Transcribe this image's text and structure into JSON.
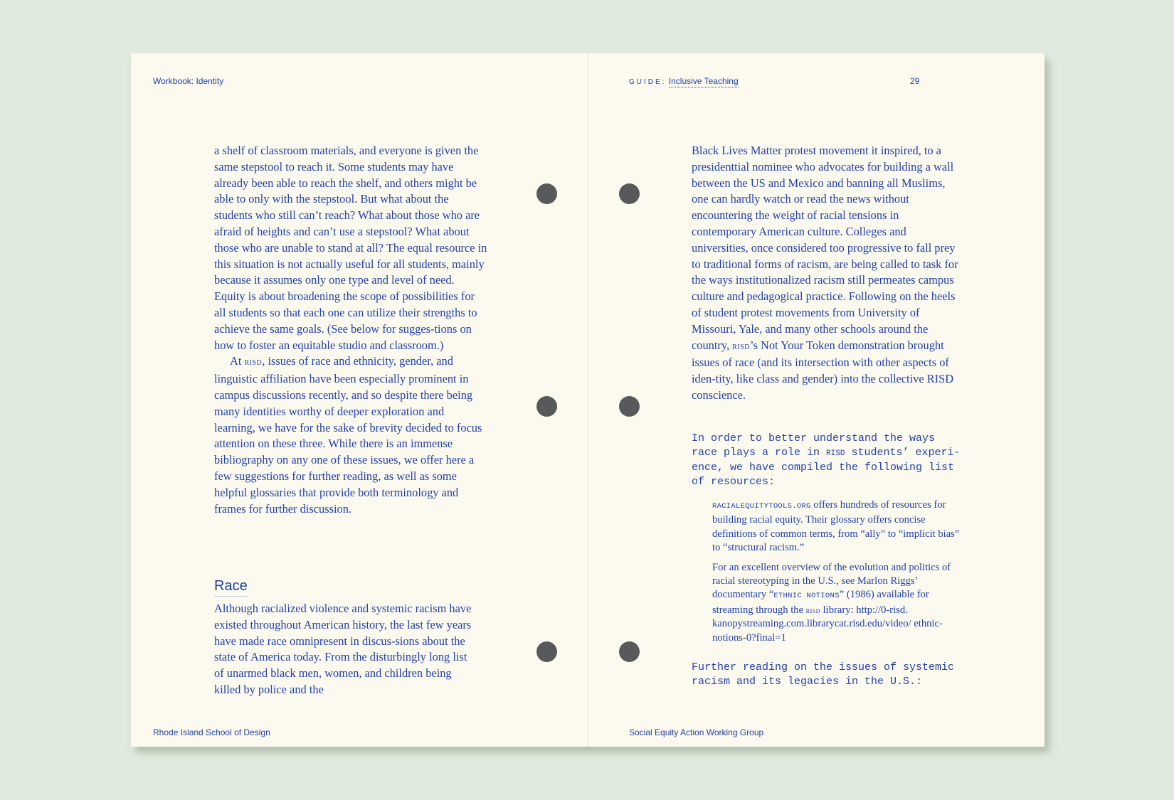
{
  "left_page": {
    "header": "Workbook: Identity",
    "footer": "Rhode Island School of Design",
    "para1": "a shelf of classroom materials, and everyone is given the same stepstool to reach it. Some students may have already been able to reach the shelf, and others might be able to only with the stepstool. But what about the students who still can’t reach? What about those who are afraid of heights and can’t use a stepstool? What about those who are unable to stand at all? The equal resource in this situation is not actually useful for all students, mainly because it assumes only one type and level of need. Equity is about broadening the scope of possibilities for all students so that each one can utilize their strengths to achieve the same goals. (See below for sugges-tions on how to foster an equitable studio and classroom.)",
    "para2_start": "At ",
    "para2_risd": "risd",
    "para2_rest": ", issues of race and ethnicity, gender, and linguistic affiliation have been especially prominent in campus discussions recently, and so despite there being many identities worthy of deeper exploration and learning, we have for the sake of brevity decided to focus attention on these three. While there is an immense bibliography on any one of these issues, we offer here a few suggestions for further reading, as well as some helpful glossaries that provide both terminology and frames for further discussion.",
    "section_heading": "Race",
    "para3": "Although racialized violence and systemic racism have existed throughout American history, the last few years have made race omnipresent in discus-sions about the state of America today.  From the disturbingly long list of unarmed black men, women, and children being killed by police and the"
  },
  "right_page": {
    "header_label": "GUIDE:",
    "header_link": "Inclusive Teaching",
    "page_number": "29",
    "footer": "Social Equity Action Working Group",
    "para1_start": "Black Lives Matter protest movement it inspired, to a presidenttial nominee who advocates for building a wall between the US and Mexico and banning all Muslims, one can hardly watch or read the news without encountering the weight of racial tensions in contemporary American culture. Colleges and universities, once considered too progressive to fall prey to traditional forms of racism, are being called to task for the ways institutionalized racism still permeates campus culture and pedagogical practice. Following on the heels of student protest movements from University of Missouri, Yale, and many other schools around the country, ",
    "para1_risd": "risd",
    "para1_end": "’s Not Your Token demonstration brought issues of race (and its intersection with other aspects of iden-tity, like class and gender) into the collective RISD conscience.",
    "intro_mono_a": "In order to better understand the ways\nrace plays a role in ",
    "intro_mono_risd": "RISD",
    "intro_mono_b": " students’ experi-\nence, we have compiled the following list\nof resources:",
    "resource1_site": "racialequitytools.org",
    "resource1_text": " offers hundreds of resources for building racial equity. Their glossary offers concise definitions of common terms, from “ally” to “implicit bias” to “structural racism.”",
    "resource2_a": "For an excellent overview of the evolution and politics of racial stereotyping in the U.S., see Marlon Riggs’ documentary “",
    "resource2_film": "ethnic notions",
    "resource2_b": "” (1986) available for streaming through the ",
    "resource2_risd": "risd",
    "resource2_c": " library: http://0-risd. kanopystreaming.com.librarycat.risd.edu/video/ ethnic-notions-0?final=1",
    "further_mono": "Further reading on the issues of systemic\nracism and its legacies in the U.S.:"
  },
  "colors": {
    "ink": "#2140ad",
    "paper": "#fcfaee",
    "background": "#e0eade",
    "punch_hole": "#58595b"
  }
}
